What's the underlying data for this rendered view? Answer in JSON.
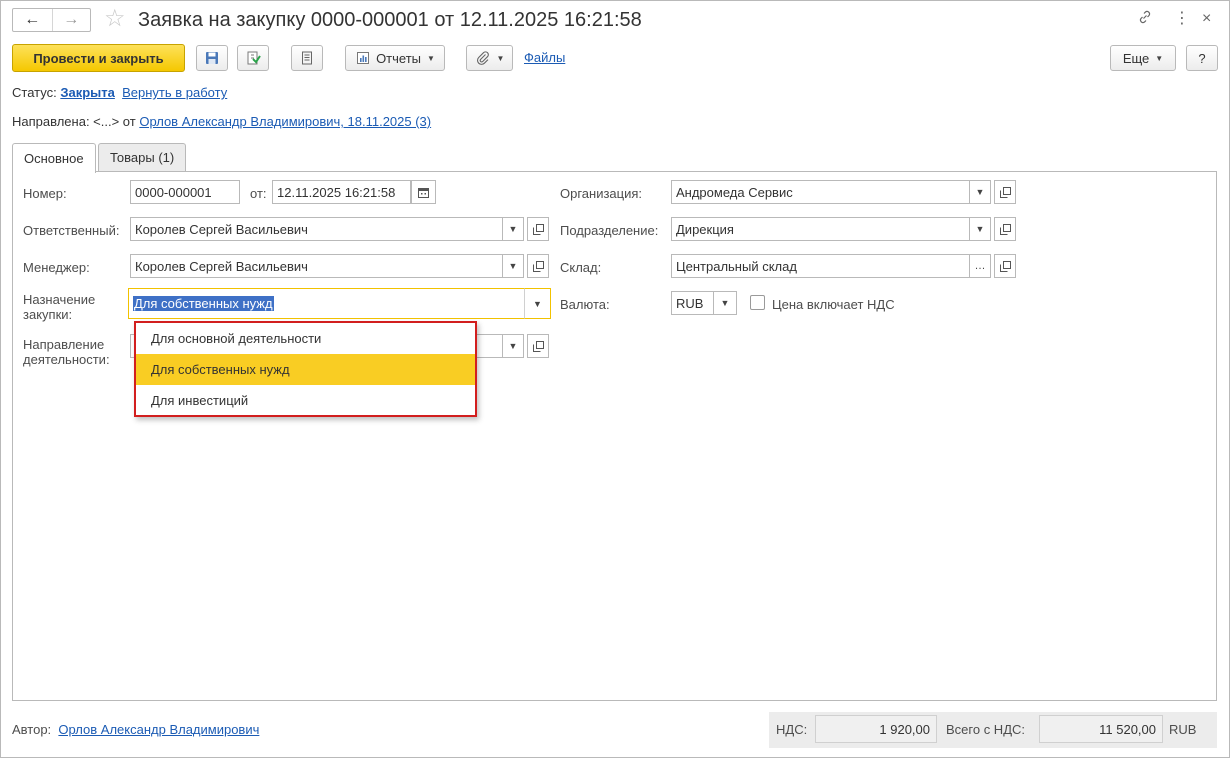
{
  "window": {
    "title": "Заявка на закупку 0000-000001 от 12.11.2025 16:21:58",
    "back_icon": "←",
    "forward_icon": "→",
    "star_icon": "☆",
    "link_icon": "⛓",
    "more_icon": "⋮",
    "close_icon": "×"
  },
  "toolbar": {
    "post_close_label": "Провести и закрыть",
    "reports_label": "Отчеты",
    "files_label": "Файлы",
    "more_label": "Еще",
    "help_label": "?"
  },
  "status": {
    "label": "Статус:",
    "value": "Закрыта",
    "action": "Вернуть в работу"
  },
  "routed": {
    "label": "Направлена: <...> от",
    "link": "Орлов Александр Владимирович, 18.11.2025 (3)"
  },
  "tabs": [
    {
      "label": "Основное"
    },
    {
      "label": "Товары (1)"
    }
  ],
  "form": {
    "number_label": "Номер:",
    "number_value": "0000-000001",
    "date_label": "от:",
    "date_value": "12.11.2025 16:21:58",
    "responsible_label": "Ответственный:",
    "responsible_value": "Королев Сергей Васильевич",
    "manager_label": "Менеджер:",
    "manager_value": "Королев Сергей Васильевич",
    "purpose_label_1": "Назначение",
    "purpose_label_2": "закупки:",
    "purpose_value": "Для собственных нужд",
    "direction_label_1": "Направление",
    "direction_label_2": "деятельности:",
    "organization_label": "Организация:",
    "organization_value": "Андромеда Сервис",
    "department_label": "Подразделение:",
    "department_value": "Дирекция",
    "warehouse_label": "Склад:",
    "warehouse_value": "Центральный склад",
    "currency_label": "Валюта:",
    "currency_value": "RUB",
    "vat_included_label": "Цена включает НДС"
  },
  "dropdown": {
    "options": [
      {
        "label": "Для основной деятельности"
      },
      {
        "label": "Для собственных нужд"
      },
      {
        "label": "Для инвестиций"
      }
    ],
    "selected": "Для собственных нужд",
    "highlight_color": "#f9cd23",
    "border_color": "#d21e1e"
  },
  "footer": {
    "author_label": "Автор:",
    "author_value": "Орлов Александр Владимирович",
    "vat_label": "НДС:",
    "vat_value": "1 920,00",
    "total_label": "Всего с НДС:",
    "total_value": "11 520,00",
    "currency": "RUB"
  },
  "colors": {
    "primary_button": "#f5c800",
    "link": "#1b5bb4",
    "focus_border": "#f2c200"
  }
}
